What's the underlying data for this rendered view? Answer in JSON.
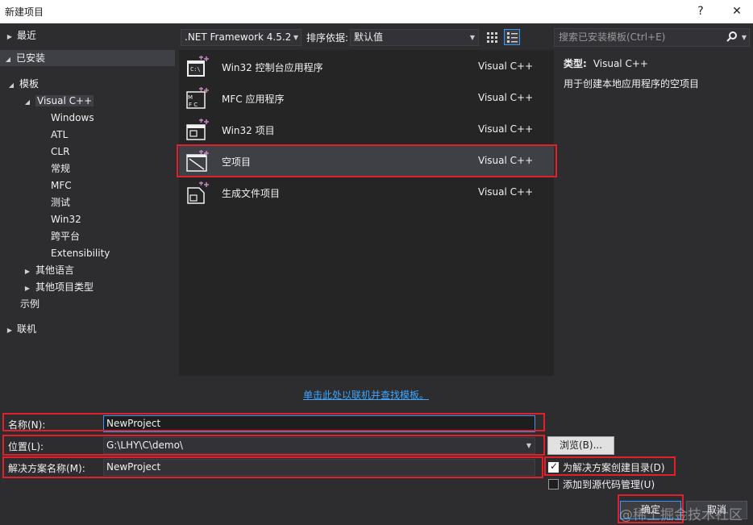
{
  "window": {
    "title": "新建项目",
    "help_glyph": "?",
    "close_glyph": "✕"
  },
  "tree": {
    "recent": "最近",
    "installed": "已安装",
    "templates": "模板",
    "visual_cpp": "Visual C++",
    "children": [
      "Windows",
      "ATL",
      "CLR",
      "常规",
      "MFC",
      "测试",
      "Win32",
      "跨平台",
      "Extensibility"
    ],
    "other_languages": "其他语言",
    "other_project_types": "其他项目类型",
    "samples": "示例",
    "online": "联机"
  },
  "toolbar": {
    "framework": ".NET Framework 4.5.2",
    "sort_label": "排序依据:",
    "sort_value": "默认值",
    "search_placeholder": "搜索已安装模板(Ctrl+E)"
  },
  "templates": [
    {
      "name": "Win32 控制台应用程序",
      "lang": "Visual C++",
      "icon": "console-app-icon"
    },
    {
      "name": "MFC 应用程序",
      "lang": "Visual C++",
      "icon": "mfc-app-icon"
    },
    {
      "name": "Win32 项目",
      "lang": "Visual C++",
      "icon": "win32-project-icon"
    },
    {
      "name": "空项目",
      "lang": "Visual C++",
      "icon": "empty-project-icon"
    },
    {
      "name": "生成文件项目",
      "lang": "Visual C++",
      "icon": "makefile-project-icon"
    }
  ],
  "online_link": "单击此处以联机并查找模板。",
  "details": {
    "type_label": "类型:",
    "type_value": "Visual C++",
    "description": "用于创建本地应用程序的空项目"
  },
  "form": {
    "name_label": "名称(N):",
    "name_value": "NewProject",
    "location_label": "位置(L):",
    "location_value": "G:\\LHY\\C\\demo\\",
    "solution_label": "解决方案名称(M):",
    "solution_value": "NewProject",
    "browse": "浏览(B)...",
    "create_dir": "为解决方案创建目录(D)",
    "create_dir_checked": true,
    "add_source_control": "添加到源代码管理(U)",
    "add_source_control_checked": false,
    "ok": "确定",
    "cancel": "取消"
  },
  "watermark": "@稀土掘金技术社区",
  "colors": {
    "background": "#2d2d30",
    "list_background": "#252526",
    "selection": "#3f3f46",
    "link": "#3ea6ff",
    "highlight_box": "#e0202a",
    "focus_border": "#3399ff"
  }
}
